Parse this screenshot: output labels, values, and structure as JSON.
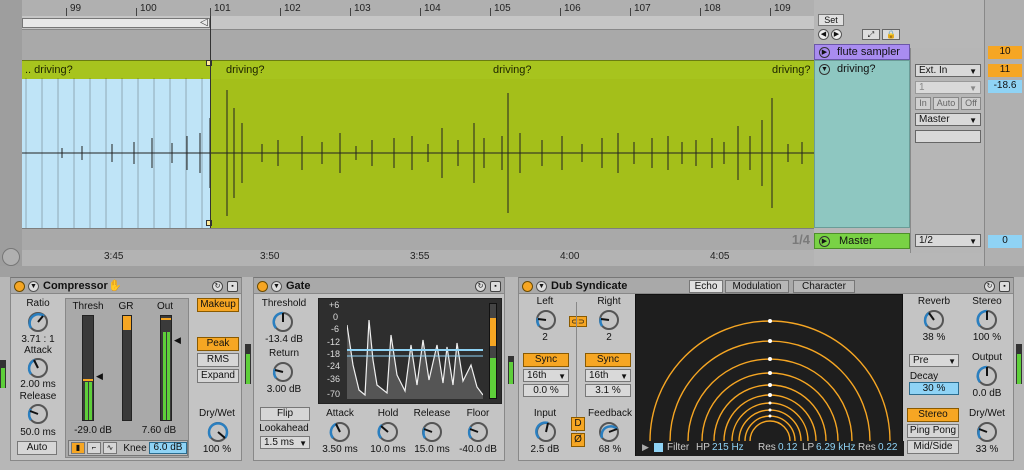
{
  "arrangement": {
    "bar_numbers": [
      "99",
      "100",
      "101",
      "102",
      "103",
      "104",
      "105",
      "106",
      "107",
      "108",
      "109"
    ],
    "time_labels": [
      "3:45",
      "3:50",
      "3:55",
      "4:00",
      "4:05"
    ],
    "loop_fraction": "1/4",
    "clip_label_partial": ".. driving?",
    "clip_label": "driving?"
  },
  "tracks": {
    "set_label": "Set",
    "track1_name": "flute sampler",
    "track2_name": "driving?",
    "master_name": "Master",
    "track1_number": "10",
    "track2_number": "11",
    "track2_volume": "-18.6",
    "master_number": "0"
  },
  "mixer": {
    "input_type": "Ext. In",
    "input_channel": "1",
    "monitor_in": "In",
    "monitor_auto": "Auto",
    "monitor_off": "Off",
    "output": "Master",
    "master_cue": "1/2"
  },
  "compressor": {
    "title": "Compressor",
    "ratio_label": "Ratio",
    "ratio_value": "3.71 : 1",
    "attack_label": "Attack",
    "attack_value": "2.00 ms",
    "release_label": "Release",
    "release_value": "50.0 ms",
    "auto_label": "Auto",
    "thresh_label": "Thresh",
    "gr_label": "GR",
    "out_label": "Out",
    "thresh_value": "-29.0 dB",
    "out_value": "7.60 dB",
    "makeup_label": "Makeup",
    "peak_label": "Peak",
    "rms_label": "RMS",
    "expand_label": "Expand",
    "drywet_label": "Dry/Wet",
    "drywet_value": "100 %",
    "knee_label": "Knee",
    "knee_value": "6.0 dB"
  },
  "gate": {
    "title": "Gate",
    "threshold_label": "Threshold",
    "threshold_value": "-13.4 dB",
    "return_label": "Return",
    "return_value": "3.00 dB",
    "flip_label": "Flip",
    "lookahead_label": "Lookahead",
    "lookahead_value": "1.5 ms",
    "attack_label": "Attack",
    "attack_value": "3.50 ms",
    "hold_label": "Hold",
    "hold_value": "10.0 ms",
    "release_label": "Release",
    "release_value": "15.0 ms",
    "floor_label": "Floor",
    "floor_value": "-40.0 dB",
    "scale": [
      "+6",
      "0",
      "-6",
      "-12",
      "-18",
      "-24",
      "-36",
      "-70"
    ]
  },
  "dub_syndicate": {
    "title": "Dub Syndicate",
    "left_label": "Left",
    "left_value": "2",
    "right_label": "Right",
    "right_value": "2",
    "sync_label": "Sync",
    "left_division": "16th",
    "right_division": "16th",
    "left_offset": "0.0 %",
    "right_offset": "3.1 %",
    "input_label": "Input",
    "input_value": "2.5 dB",
    "feedback_label": "Feedback",
    "feedback_value": "68 %",
    "d_label": "D",
    "phase_label": "Ø",
    "tabs": [
      "Echo",
      "Modulation",
      "Character"
    ],
    "filter_label": "Filter",
    "hp_label": "HP",
    "hp_value": "215 Hz",
    "res_label": "Res",
    "hp_res_value": "0.12",
    "lp_label": "LP",
    "lp_value": "6.29 kHz",
    "lp_res_value": "0.22",
    "reverb_label": "Reverb",
    "reverb_value": "38 %",
    "stereo_label": "Stereo",
    "stereo_value": "100 %",
    "pre_label": "Pre",
    "decay_label": "Decay",
    "decay_value": "30 %",
    "output_label": "Output",
    "output_value": "0.0 dB",
    "stereo_btn": "Stereo",
    "pingpong_btn": "Ping Pong",
    "midside_btn": "Mid/Side",
    "drywet_label": "Dry/Wet",
    "drywet_value": "33 %"
  },
  "colors": {
    "clip_green": "#a4bf1a",
    "clip_selected": "#bfe4f7",
    "accent_orange": "#f6a623",
    "track_purple": "#a98cf0",
    "track_teal": "#8ec7c1",
    "master_green": "#79d245"
  }
}
